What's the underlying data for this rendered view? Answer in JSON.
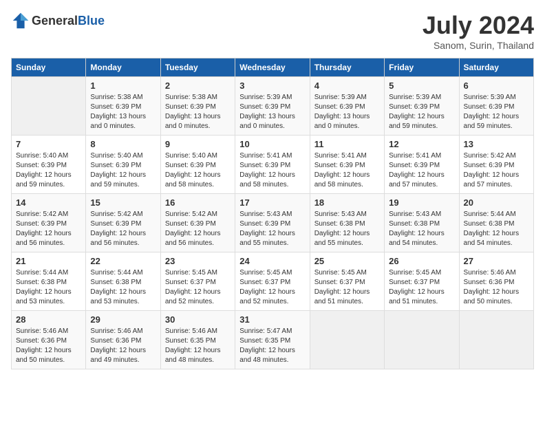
{
  "header": {
    "logo_general": "General",
    "logo_blue": "Blue",
    "month_year": "July 2024",
    "location": "Sanom, Surin, Thailand"
  },
  "days_of_week": [
    "Sunday",
    "Monday",
    "Tuesday",
    "Wednesday",
    "Thursday",
    "Friday",
    "Saturday"
  ],
  "weeks": [
    [
      {
        "day": "",
        "info": ""
      },
      {
        "day": "1",
        "info": "Sunrise: 5:38 AM\nSunset: 6:39 PM\nDaylight: 13 hours\nand 0 minutes."
      },
      {
        "day": "2",
        "info": "Sunrise: 5:38 AM\nSunset: 6:39 PM\nDaylight: 13 hours\nand 0 minutes."
      },
      {
        "day": "3",
        "info": "Sunrise: 5:39 AM\nSunset: 6:39 PM\nDaylight: 13 hours\nand 0 minutes."
      },
      {
        "day": "4",
        "info": "Sunrise: 5:39 AM\nSunset: 6:39 PM\nDaylight: 13 hours\nand 0 minutes."
      },
      {
        "day": "5",
        "info": "Sunrise: 5:39 AM\nSunset: 6:39 PM\nDaylight: 12 hours\nand 59 minutes."
      },
      {
        "day": "6",
        "info": "Sunrise: 5:39 AM\nSunset: 6:39 PM\nDaylight: 12 hours\nand 59 minutes."
      }
    ],
    [
      {
        "day": "7",
        "info": "Sunrise: 5:40 AM\nSunset: 6:39 PM\nDaylight: 12 hours\nand 59 minutes."
      },
      {
        "day": "8",
        "info": "Sunrise: 5:40 AM\nSunset: 6:39 PM\nDaylight: 12 hours\nand 59 minutes."
      },
      {
        "day": "9",
        "info": "Sunrise: 5:40 AM\nSunset: 6:39 PM\nDaylight: 12 hours\nand 58 minutes."
      },
      {
        "day": "10",
        "info": "Sunrise: 5:41 AM\nSunset: 6:39 PM\nDaylight: 12 hours\nand 58 minutes."
      },
      {
        "day": "11",
        "info": "Sunrise: 5:41 AM\nSunset: 6:39 PM\nDaylight: 12 hours\nand 58 minutes."
      },
      {
        "day": "12",
        "info": "Sunrise: 5:41 AM\nSunset: 6:39 PM\nDaylight: 12 hours\nand 57 minutes."
      },
      {
        "day": "13",
        "info": "Sunrise: 5:42 AM\nSunset: 6:39 PM\nDaylight: 12 hours\nand 57 minutes."
      }
    ],
    [
      {
        "day": "14",
        "info": "Sunrise: 5:42 AM\nSunset: 6:39 PM\nDaylight: 12 hours\nand 56 minutes."
      },
      {
        "day": "15",
        "info": "Sunrise: 5:42 AM\nSunset: 6:39 PM\nDaylight: 12 hours\nand 56 minutes."
      },
      {
        "day": "16",
        "info": "Sunrise: 5:42 AM\nSunset: 6:39 PM\nDaylight: 12 hours\nand 56 minutes."
      },
      {
        "day": "17",
        "info": "Sunrise: 5:43 AM\nSunset: 6:39 PM\nDaylight: 12 hours\nand 55 minutes."
      },
      {
        "day": "18",
        "info": "Sunrise: 5:43 AM\nSunset: 6:38 PM\nDaylight: 12 hours\nand 55 minutes."
      },
      {
        "day": "19",
        "info": "Sunrise: 5:43 AM\nSunset: 6:38 PM\nDaylight: 12 hours\nand 54 minutes."
      },
      {
        "day": "20",
        "info": "Sunrise: 5:44 AM\nSunset: 6:38 PM\nDaylight: 12 hours\nand 54 minutes."
      }
    ],
    [
      {
        "day": "21",
        "info": "Sunrise: 5:44 AM\nSunset: 6:38 PM\nDaylight: 12 hours\nand 53 minutes."
      },
      {
        "day": "22",
        "info": "Sunrise: 5:44 AM\nSunset: 6:38 PM\nDaylight: 12 hours\nand 53 minutes."
      },
      {
        "day": "23",
        "info": "Sunrise: 5:45 AM\nSunset: 6:37 PM\nDaylight: 12 hours\nand 52 minutes."
      },
      {
        "day": "24",
        "info": "Sunrise: 5:45 AM\nSunset: 6:37 PM\nDaylight: 12 hours\nand 52 minutes."
      },
      {
        "day": "25",
        "info": "Sunrise: 5:45 AM\nSunset: 6:37 PM\nDaylight: 12 hours\nand 51 minutes."
      },
      {
        "day": "26",
        "info": "Sunrise: 5:45 AM\nSunset: 6:37 PM\nDaylight: 12 hours\nand 51 minutes."
      },
      {
        "day": "27",
        "info": "Sunrise: 5:46 AM\nSunset: 6:36 PM\nDaylight: 12 hours\nand 50 minutes."
      }
    ],
    [
      {
        "day": "28",
        "info": "Sunrise: 5:46 AM\nSunset: 6:36 PM\nDaylight: 12 hours\nand 50 minutes."
      },
      {
        "day": "29",
        "info": "Sunrise: 5:46 AM\nSunset: 6:36 PM\nDaylight: 12 hours\nand 49 minutes."
      },
      {
        "day": "30",
        "info": "Sunrise: 5:46 AM\nSunset: 6:35 PM\nDaylight: 12 hours\nand 48 minutes."
      },
      {
        "day": "31",
        "info": "Sunrise: 5:47 AM\nSunset: 6:35 PM\nDaylight: 12 hours\nand 48 minutes."
      },
      {
        "day": "",
        "info": ""
      },
      {
        "day": "",
        "info": ""
      },
      {
        "day": "",
        "info": ""
      }
    ]
  ]
}
